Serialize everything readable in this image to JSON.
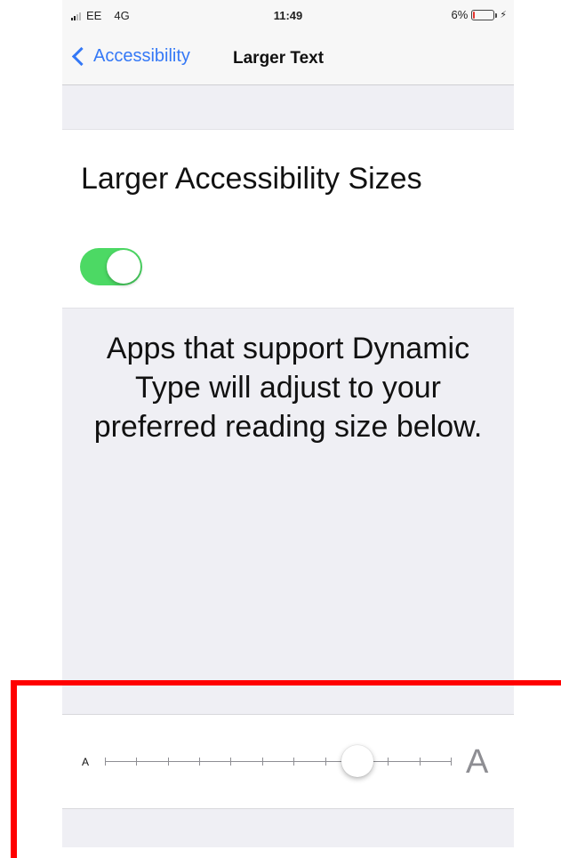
{
  "status_bar": {
    "carrier": "EE",
    "network": "4G",
    "time": "11:49",
    "battery_percent": "6%",
    "battery_level": 0.06
  },
  "nav": {
    "back_label": "Accessibility",
    "title": "Larger Text"
  },
  "toggle_row": {
    "label": "Larger Accessibility Sizes",
    "enabled": true
  },
  "description": "Apps that support Dynamic Type will adjust to your preferred reading size below.",
  "text_size_slider": {
    "min_label": "A",
    "max_label": "A",
    "steps": 12,
    "selected_step": 8
  },
  "colors": {
    "accent_blue": "#3478f6",
    "toggle_on": "#4cd964",
    "background": "#efeff4",
    "annotation_red": "#ff0000"
  },
  "icons": [
    "back-chevron-icon",
    "signal-icon",
    "battery-icon",
    "charging-icon"
  ]
}
